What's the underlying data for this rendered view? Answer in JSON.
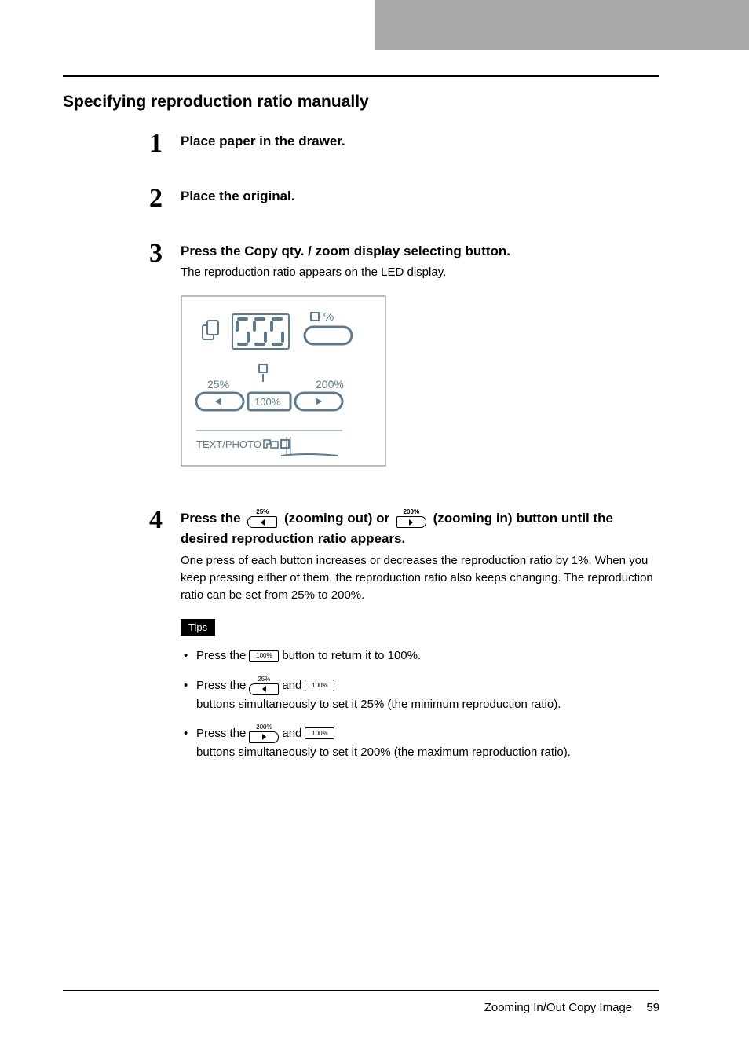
{
  "section_title": "Specifying reproduction ratio manually",
  "steps": {
    "s1": {
      "num": "1",
      "title": "Place paper in the drawer."
    },
    "s2": {
      "num": "2",
      "title": "Place the original."
    },
    "s3": {
      "num": "3",
      "title": "Press the Copy qty. / zoom display selecting button.",
      "desc": "The reproduction ratio appears on the LED display."
    },
    "s4": {
      "num": "4",
      "title_a": "Press the",
      "title_b": "(zooming out) or",
      "title_c": "(zooming in) button until the desired reproduction ratio appears.",
      "desc": "One press of each button increases or decreases the reproduction ratio by 1%. When you keep pressing either of them, the reproduction ratio also keeps changing. The reproduction ratio can be set from 25% to 200%."
    }
  },
  "tips_label": "Tips",
  "tips": {
    "t1_a": "Press the",
    "t1_b": "button to return it to 100%.",
    "t2_a": "Press the",
    "t2_b": "and",
    "t2_c": "buttons simultaneously to set it 25% (the minimum reproduction ratio).",
    "t3_a": "Press the",
    "t3_b": "and",
    "t3_c": "buttons simultaneously to set it 200% (the maximum reproduction ratio)."
  },
  "btn_labels": {
    "zoom_out": "25%",
    "zoom_in": "200%",
    "reset": "100%"
  },
  "panel": {
    "pct_symbol": "%",
    "min": "25%",
    "max": "200%",
    "reset": "100%",
    "mode": "TEXT/PHOTO"
  },
  "footer_text": "Zooming In/Out Copy Image",
  "footer_page": "59"
}
